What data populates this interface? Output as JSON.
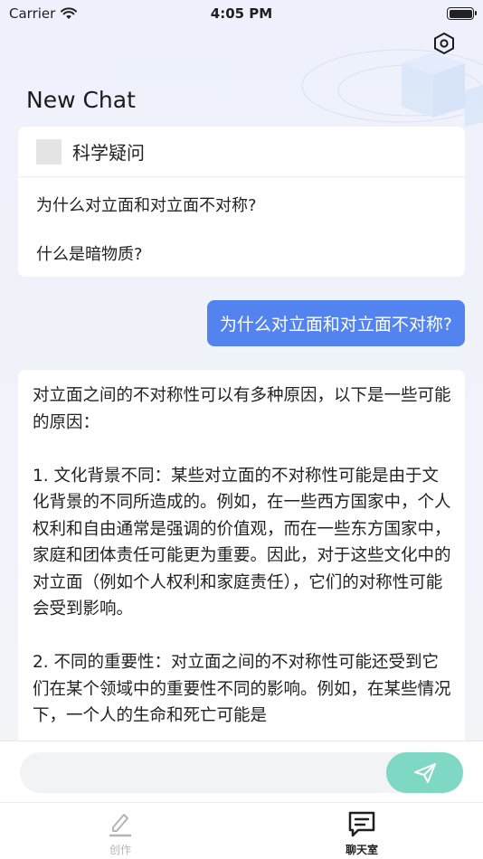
{
  "status_bar": {
    "carrier": "Carrier",
    "time": "4:05 PM"
  },
  "header": {
    "title": "New Chat",
    "settings_icon": "gear-hexagon-icon"
  },
  "suggestions": {
    "title": "科学疑问",
    "items": [
      "为什么对立面和对立面不对称?",
      "什么是暗物质?"
    ]
  },
  "messages": {
    "user": "为什么对立面和对立面不对称?",
    "assistant": "对立面之间的不对称性可以有多种原因，以下是一些可能的原因：\n\n1. 文化背景不同：某些对立面的不对称性可能是由于文化背景的不同所造成的。例如，在一些西方国家中，个人权利和自由通常是强调的价值观，而在一些东方国家中，家庭和团体责任可能更为重要。因此，对于这些文化中的对立面（例如个人权利和家庭责任），它们的对称性可能会受到影响。\n\n2. 不同的重要性：对立面之间的不对称性可能还受到它们在某个领域中的重要性不同的影响。例如，在某些情况下，一个人的生命和死亡可能是"
  },
  "input": {
    "placeholder": "",
    "send_icon": "paper-plane-icon"
  },
  "tabs": [
    {
      "label": "创作",
      "icon": "pencil-icon",
      "active": false
    },
    {
      "label": "聊天室",
      "icon": "chat-bubble-icon",
      "active": true
    }
  ],
  "colors": {
    "user_bubble": "#5283ef",
    "send_button": "#7fd8c3"
  }
}
